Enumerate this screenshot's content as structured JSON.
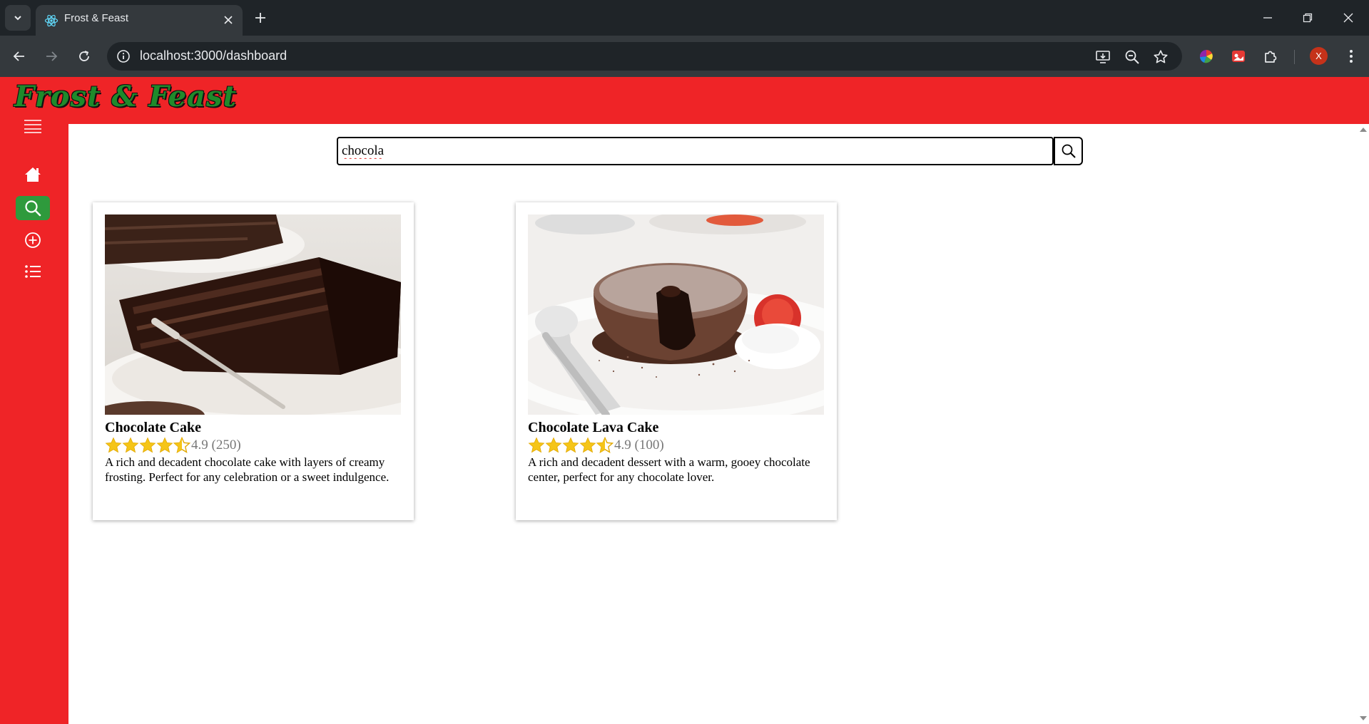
{
  "browser": {
    "tab_title": "Frost & Feast",
    "url": "localhost:3000/dashboard",
    "profile_initial": "X"
  },
  "app": {
    "logo": "Frost & Feast",
    "colors": {
      "brand_red": "#ef2427",
      "active_green": "#2e9a3c",
      "star_gold": "#f5c518"
    },
    "sidebar": [
      {
        "name": "menu",
        "icon": "hamburger-icon"
      },
      {
        "name": "home",
        "icon": "home-icon"
      },
      {
        "name": "search",
        "icon": "search-icon",
        "active": true
      },
      {
        "name": "add",
        "icon": "plus-circle-icon"
      },
      {
        "name": "list",
        "icon": "list-icon"
      }
    ],
    "search": {
      "value": "chocola"
    },
    "cards": [
      {
        "title": "Chocolate Cake",
        "rating": 4.9,
        "rating_text": "4.9 (250)",
        "description": "A rich and decadent chocolate cake with layers of creamy frosting. Perfect for any celebration or a sweet indulgence."
      },
      {
        "title": "Chocolate Lava Cake",
        "rating": 4.9,
        "rating_text": "4.9 (100)",
        "description": "A rich and decadent dessert with a warm, gooey chocolate center, perfect for any chocolate lover."
      }
    ]
  }
}
